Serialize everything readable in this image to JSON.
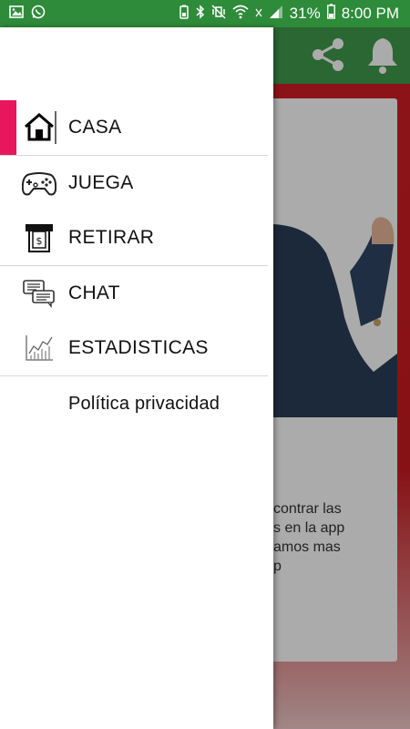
{
  "status_bar": {
    "battery": "31%",
    "time": "8:00 PM",
    "bg_color": "#2e8b3a"
  },
  "background_app": {
    "toolbar_color": "#3f9a4b",
    "accent_color": "#d11e24",
    "card_text": "contrar las\ns en la app\namos mas\np"
  },
  "drawer": {
    "active_color": "#e8175d",
    "items": [
      {
        "label": "CASA",
        "icon": "home-icon",
        "active": true
      },
      {
        "label": "JUEGA",
        "icon": "gamepad-icon"
      },
      {
        "label": "RETIRAR",
        "icon": "atm-withdraw-icon"
      },
      {
        "label": "CHAT",
        "icon": "chat-icon"
      },
      {
        "label": "ESTADISTICAS",
        "icon": "statistics-icon"
      }
    ],
    "privacy_label": "Política privacidad"
  }
}
